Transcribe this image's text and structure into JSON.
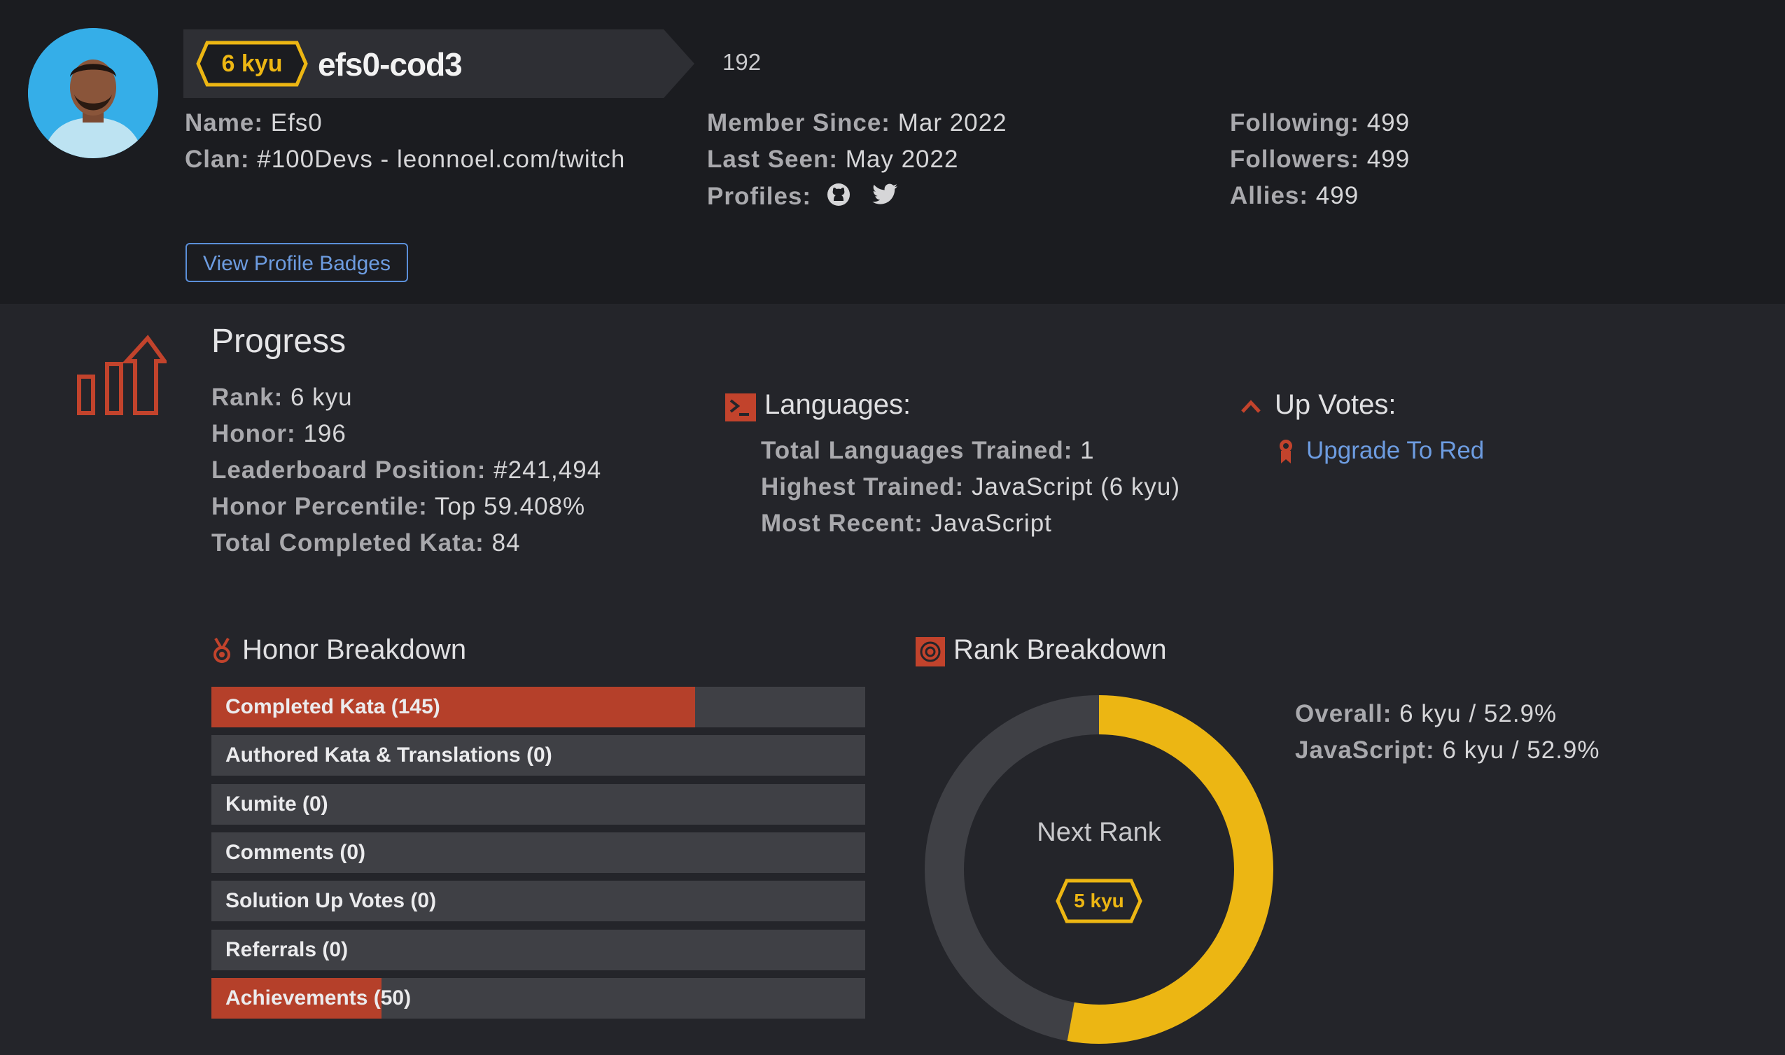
{
  "profile": {
    "rank_badge": "6 kyu",
    "username": "efs0-cod3",
    "honor": "192",
    "name_label": "Name:",
    "name": "Efs0",
    "clan_label": "Clan:",
    "clan": "#100Devs - leonnoel.com/twitch",
    "member_since_label": "Member Since:",
    "member_since": "Mar 2022",
    "last_seen_label": "Last Seen:",
    "last_seen": "May 2022",
    "profiles_label": "Profiles:",
    "profile_icons": [
      "github-icon",
      "twitter-icon"
    ],
    "following_label": "Following:",
    "following": "499",
    "followers_label": "Followers:",
    "followers": "499",
    "allies_label": "Allies:",
    "allies": "499",
    "view_badges_button": "View Profile Badges"
  },
  "progress": {
    "title": "Progress",
    "rank_label": "Rank:",
    "rank": "6 kyu",
    "honor_label": "Honor:",
    "honor": "196",
    "leaderboard_label": "Leaderboard Position:",
    "leaderboard": "#241,494",
    "percentile_label": "Honor Percentile:",
    "percentile": "Top 59.408%",
    "completed_label": "Total Completed Kata:",
    "completed": "84"
  },
  "languages": {
    "title": "Languages:",
    "total_label": "Total Languages Trained:",
    "total": "1",
    "highest_label": "Highest Trained:",
    "highest": "JavaScript (6 kyu)",
    "recent_label": "Most Recent:",
    "recent": "JavaScript"
  },
  "upvotes": {
    "title": "Up Votes:",
    "link": "Upgrade To Red"
  },
  "honor_breakdown": {
    "title": "Honor Breakdown",
    "items": [
      {
        "label": "Completed Kata (145)",
        "fill_fraction": 0.74
      },
      {
        "label": "Authored Kata & Translations (0)",
        "fill_fraction": 0
      },
      {
        "label": "Kumite (0)",
        "fill_fraction": 0
      },
      {
        "label": "Comments (0)",
        "fill_fraction": 0
      },
      {
        "label": "Solution Up Votes (0)",
        "fill_fraction": 0
      },
      {
        "label": "Referrals (0)",
        "fill_fraction": 0
      },
      {
        "label": "Achievements (50)",
        "fill_fraction": 0.26
      }
    ]
  },
  "rank_breakdown": {
    "title": "Rank Breakdown",
    "overall_label": "Overall:",
    "overall": "6 kyu / 52.9%",
    "javascript_label": "JavaScript:",
    "javascript": "6 kyu / 52.9%",
    "next_rank_label": "Next Rank",
    "next_rank": "5 kyu",
    "progress_fraction": 0.529
  },
  "colors": {
    "rank_yellow": "#ecb613",
    "accent_red": "#b5402a",
    "link_blue": "#6d9ce0"
  }
}
